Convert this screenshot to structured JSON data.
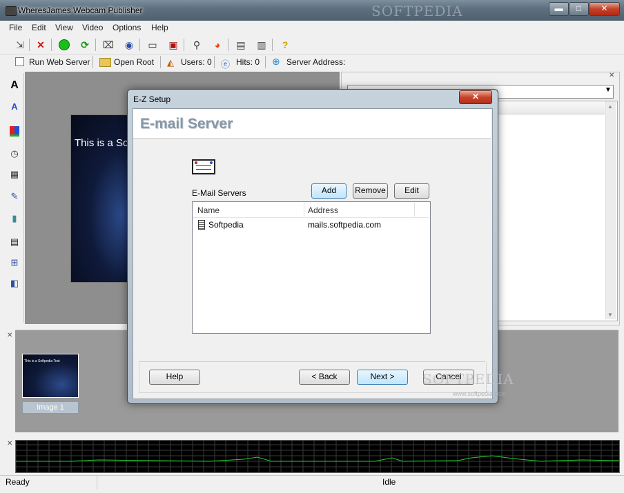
{
  "window": {
    "title": "WheresJames Webcam Publisher",
    "controls": {
      "minimize": "▬",
      "maximize": "□",
      "close": "✕"
    }
  },
  "menu": [
    "File",
    "Edit",
    "View",
    "Video",
    "Options",
    "Help"
  ],
  "toolbar1": {
    "icons": [
      "new-icon",
      "delete-icon",
      "start-icon",
      "refresh-icon",
      "capture-icon",
      "eye-icon",
      "card-icon",
      "save-icon",
      "wand-icon",
      "colors-icon",
      "camera-icon",
      "camera2-icon",
      "help-icon"
    ]
  },
  "toolbar2": {
    "run_web_server": "Run Web Server",
    "open_root": "Open Root",
    "users": "Users: 0",
    "hits": "Hits: 0",
    "server_address": "Server Address:"
  },
  "left_toolbar": {
    "icons": [
      "text-icon",
      "text-effect-icon",
      "color-block-icon",
      "clock-icon",
      "grid-icon",
      "paint-icon",
      "brush-icon",
      "film-icon",
      "network-icon",
      "devices-icon"
    ],
    "text_glyph": "A"
  },
  "canvas": {
    "preview_text": "This is a So"
  },
  "thumbnails": {
    "items": [
      {
        "label": "Image 1",
        "caption": "This is a Softpedia Test"
      }
    ]
  },
  "status": {
    "left": "Ready",
    "center": "Idle"
  },
  "dialog": {
    "title": "E-Z Setup",
    "close": "✕",
    "heading": "E-mail Server",
    "servers_label": "E-Mail Servers",
    "add": "Add",
    "remove": "Remove",
    "edit": "Edit",
    "columns": {
      "name": "Name",
      "address": "Address"
    },
    "rows": [
      {
        "name": "Softpedia",
        "address": "mails.softpedia.com"
      }
    ],
    "help": "Help",
    "back": "< Back",
    "next": "Next >",
    "cancel": "Cancel"
  },
  "watermark": {
    "brand": "SOFTPEDIA",
    "url": "www.softpedia.com"
  },
  "colors": {
    "accent": "#3c7fb1",
    "graph_line": "#1fd12b",
    "dialog_heading": "#8797a6"
  }
}
